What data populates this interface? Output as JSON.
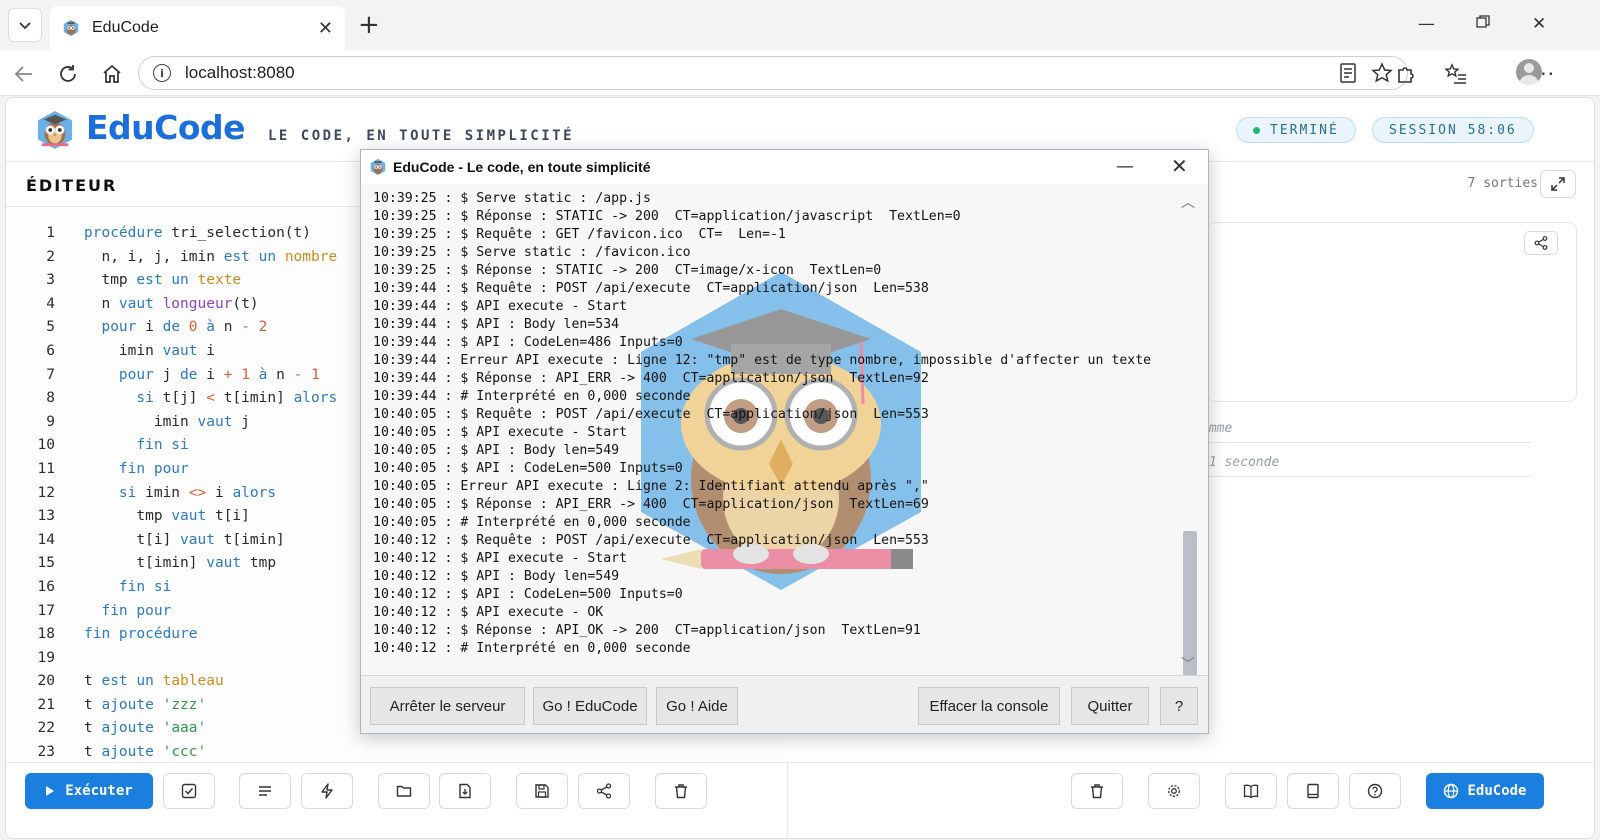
{
  "browser": {
    "tab_title": "EduCode",
    "url": "localhost:8080"
  },
  "app": {
    "brand": "EduCode",
    "tagline": "LE CODE, EN TOUTE SIMPLICITÉ",
    "status_badge": "TERMINÉ",
    "session_badge": "SESSION 58:06",
    "editor_title": "ÉDITEUR",
    "output_count": "7 sorties",
    "output_line_1": "amme",
    "output_line_2": "21 seconde",
    "run_label": "Exécuter",
    "educode_button": "EduCode",
    "colors": {
      "accent": "#1b7fe0",
      "brand": "#1b6fdc",
      "keyword": "#2b7bc4",
      "operator": "#e05d3a",
      "string": "#2e9a4a",
      "status_dot": "#22b573"
    }
  },
  "code": {
    "line_numbers": [
      "1",
      "2",
      "3",
      "4",
      "5",
      "6",
      "7",
      "8",
      "9",
      "10",
      "11",
      "12",
      "13",
      "14",
      "15",
      "16",
      "17",
      "18",
      "19",
      "20",
      "21",
      "22",
      "23"
    ]
  },
  "toolbar_icons": [
    "play-icon",
    "check-icon",
    "format-icon",
    "bolt-icon",
    "folder-icon",
    "file-import-icon",
    "save-icon",
    "share-icon",
    "trash-icon",
    "trash-icon",
    "gear-icon",
    "book-icon",
    "notebook-icon",
    "help-icon",
    "globe-icon"
  ],
  "window": {
    "title": "EduCode - Le code, en toute simplicité",
    "console_lines": [
      "10:39:25 : $ Serve static : /app.js",
      "10:39:25 : $ Réponse : STATIC -> 200  CT=application/javascript  TextLen=0",
      "10:39:25 : $ Requête : GET /favicon.ico  CT=  Len=-1",
      "10:39:25 : $ Serve static : /favicon.ico",
      "10:39:25 : $ Réponse : STATIC -> 200  CT=image/x-icon  TextLen=0",
      "10:39:44 : $ Requête : POST /api/execute  CT=application/json  Len=538",
      "10:39:44 : $ API execute - Start",
      "10:39:44 : $ API : Body len=534",
      "10:39:44 : $ API : CodeLen=486 Inputs=0",
      "10:39:44 : Erreur API execute : Ligne 12: \"tmp\" est de type nombre, impossible d'affecter un texte",
      "10:39:44 : $ Réponse : API_ERR -> 400  CT=application/json  TextLen=92",
      "10:39:44 : # Interprété en 0,000 seconde",
      "10:40:05 : $ Requête : POST /api/execute  CT=application/json  Len=553",
      "10:40:05 : $ API execute - Start",
      "10:40:05 : $ API : Body len=549",
      "10:40:05 : $ API : CodeLen=500 Inputs=0",
      "10:40:05 : Erreur API execute : Ligne 2: Identifiant attendu après \",\"",
      "10:40:05 : $ Réponse : API_ERR -> 400  CT=application/json  TextLen=69",
      "10:40:05 : # Interprété en 0,000 seconde",
      "10:40:12 : $ Requête : POST /api/execute  CT=application/json  Len=553",
      "10:40:12 : $ API execute - Start",
      "10:40:12 : $ API : Body len=549",
      "10:40:12 : $ API : CodeLen=500 Inputs=0",
      "10:40:12 : $ API execute - OK",
      "10:40:12 : $ Réponse : API_OK -> 200  CT=application/json  TextLen=91",
      "10:40:12 : # Interprété en 0,000 seconde"
    ],
    "buttons": {
      "stop": "Arrêter le serveur",
      "go_educode": "Go ! EduCode",
      "go_help": "Go ! Aide",
      "clear": "Effacer la console",
      "quit": "Quitter",
      "help": "?"
    }
  }
}
